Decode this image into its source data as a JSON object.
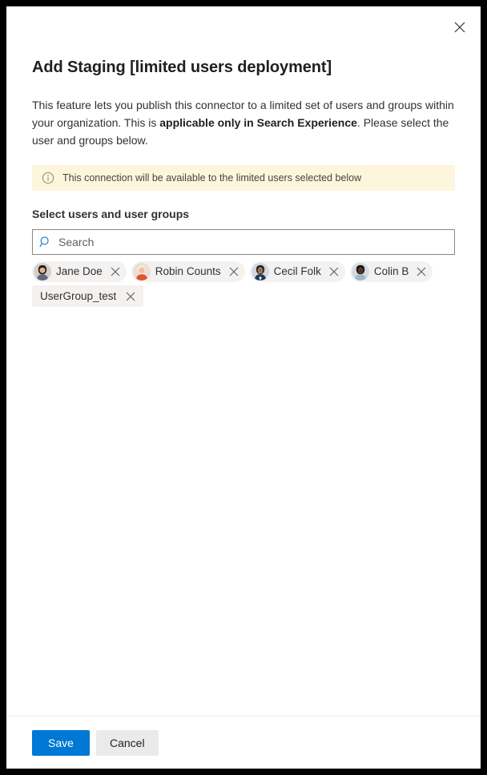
{
  "panel": {
    "close_label": "Close",
    "title": "Add Staging [limited users deployment]",
    "description_part1": "This feature lets you publish this connector to a limited set of users and groups within your organization. This is ",
    "description_bold": "applicable only in Search Experience",
    "description_part2": ". Please select the user and groups below."
  },
  "info_bar": {
    "icon": "info-circle-icon",
    "text": "This connection will be available to the limited users selected below",
    "background_color": "#fdf6dd"
  },
  "field": {
    "label": "Select users and user groups"
  },
  "search": {
    "icon": "search-icon",
    "placeholder": "Search",
    "value": "",
    "icon_color": "#0078d4"
  },
  "selected": [
    {
      "name": "Jane Doe",
      "type": "person",
      "avatar": "photo-jane-doe",
      "remove_label": "Remove"
    },
    {
      "name": "Robin Counts",
      "type": "person",
      "avatar": "photo-robin-counts",
      "remove_label": "Remove"
    },
    {
      "name": "Cecil Folk",
      "type": "person",
      "avatar": "photo-cecil-folk",
      "remove_label": "Remove"
    },
    {
      "name": "Colin B",
      "type": "person",
      "avatar": "photo-colin-b",
      "remove_label": "Remove"
    },
    {
      "name": "UserGroup_test",
      "type": "group",
      "avatar": "",
      "remove_label": "Remove"
    }
  ],
  "footer": {
    "save_label": "Save",
    "cancel_label": "Cancel",
    "primary_color": "#0078d4",
    "secondary_color": "#eaeaea"
  }
}
